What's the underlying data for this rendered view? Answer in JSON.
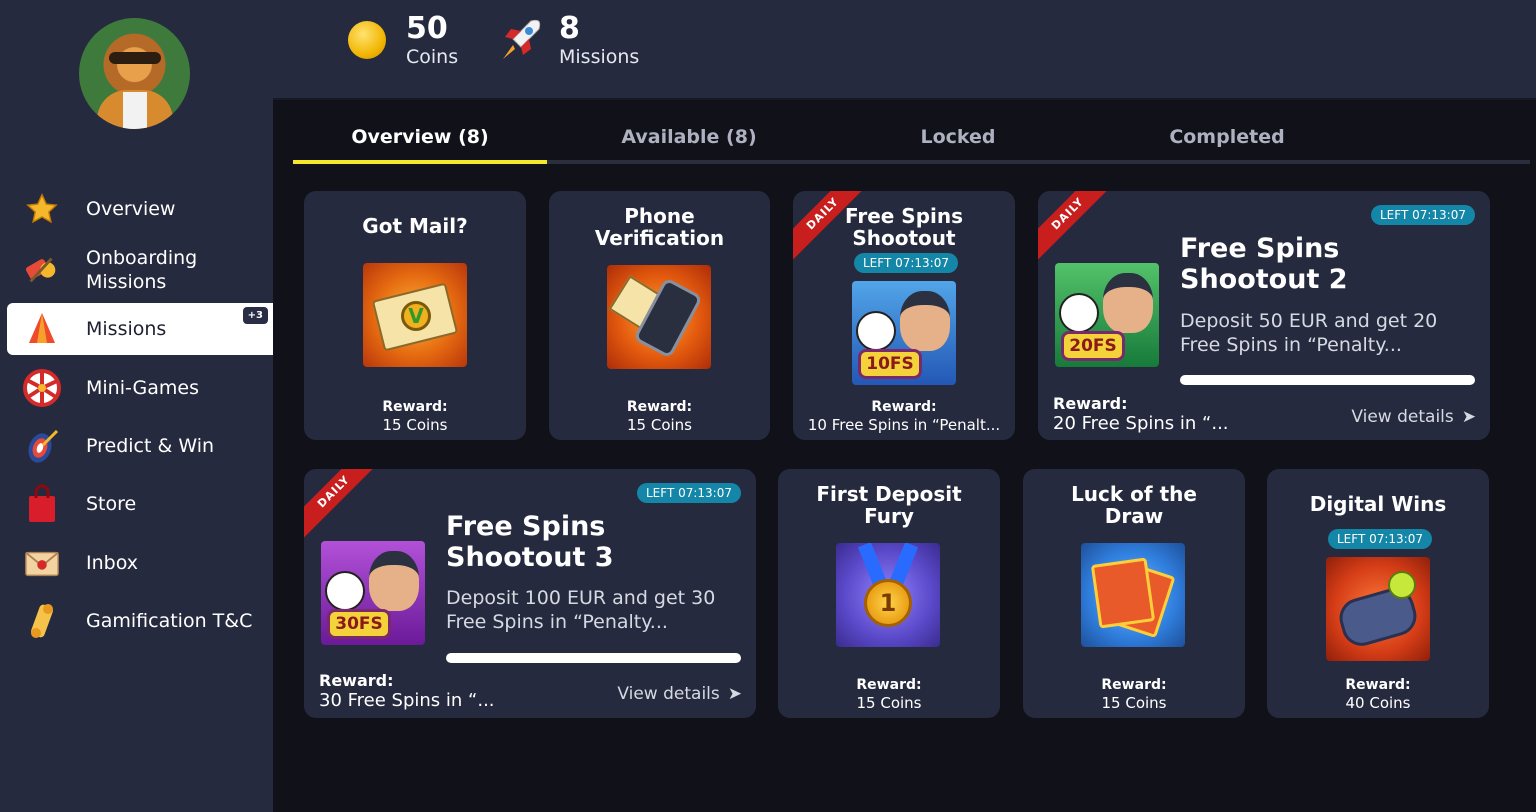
{
  "sidebar": {
    "items": [
      {
        "label": "Overview",
        "icon": "star-icon"
      },
      {
        "label": "Onboarding\nMissions",
        "icon": "onboarding-icon"
      },
      {
        "label": "Missions",
        "icon": "missions-icon",
        "badge": "+3",
        "active": true
      },
      {
        "label": "Mini-Games",
        "icon": "wheel-icon"
      },
      {
        "label": "Predict & Win",
        "icon": "target-icon"
      },
      {
        "label": "Store",
        "icon": "shopping-bag-icon"
      },
      {
        "label": "Inbox",
        "icon": "envelope-icon"
      },
      {
        "label": "Gamification T&C",
        "icon": "scroll-icon"
      }
    ]
  },
  "header": {
    "coins": {
      "value": "50",
      "label": "Coins"
    },
    "missions": {
      "value": "8",
      "label": "Missions"
    }
  },
  "tabs": [
    {
      "label": "Overview (8)",
      "active": true
    },
    {
      "label": "Available (8)"
    },
    {
      "label": "Locked"
    },
    {
      "label": "Completed"
    }
  ],
  "cards": {
    "got_mail": {
      "title": "Got Mail?",
      "reward_label": "Reward:",
      "reward": "15 Coins"
    },
    "phone": {
      "title": "Phone\nVerification",
      "reward_label": "Reward:",
      "reward": "15 Coins"
    },
    "fs1": {
      "ribbon": "DAILY",
      "title": "Free Spins\nShootout",
      "timer": "LEFT 07:13:07",
      "thumb_text": "10FS",
      "reward_label": "Reward:",
      "reward": "10 Free Spins in “Penalt..."
    },
    "fs2": {
      "ribbon": "DAILY",
      "title": "Free Spins\nShootout 2",
      "timer": "LEFT 07:13:07",
      "thumb_text": "20FS",
      "description": "Deposit 50 EUR and get 20\nFree Spins in “Penalty...",
      "progress": 1.0,
      "reward_label": "Reward:",
      "reward": "20 Free Spins in “...",
      "details": "View details"
    },
    "fs3": {
      "ribbon": "DAILY",
      "title": "Free Spins\nShootout 3",
      "timer": "LEFT 07:13:07",
      "thumb_text": "30FS",
      "description": "Deposit 100 EUR and get 30\nFree Spins in “Penalty...",
      "progress": 1.0,
      "reward_label": "Reward:",
      "reward": "30 Free Spins in “...",
      "details": "View details"
    },
    "first_deposit": {
      "title": "First Deposit\nFury",
      "medal": "1",
      "reward_label": "Reward:",
      "reward": "15 Coins"
    },
    "luck": {
      "title": "Luck of the\nDraw",
      "reward_label": "Reward:",
      "reward": "15 Coins"
    },
    "digital": {
      "title": "Digital Wins",
      "timer": "LEFT 07:13:07",
      "reward_label": "Reward:",
      "reward": "40 Coins"
    }
  },
  "colors": {
    "accent": "#f5e72c",
    "timer": "#1486a8",
    "ribbon": "#c81e1e",
    "panel": "#262a3e",
    "background": "#101119"
  }
}
